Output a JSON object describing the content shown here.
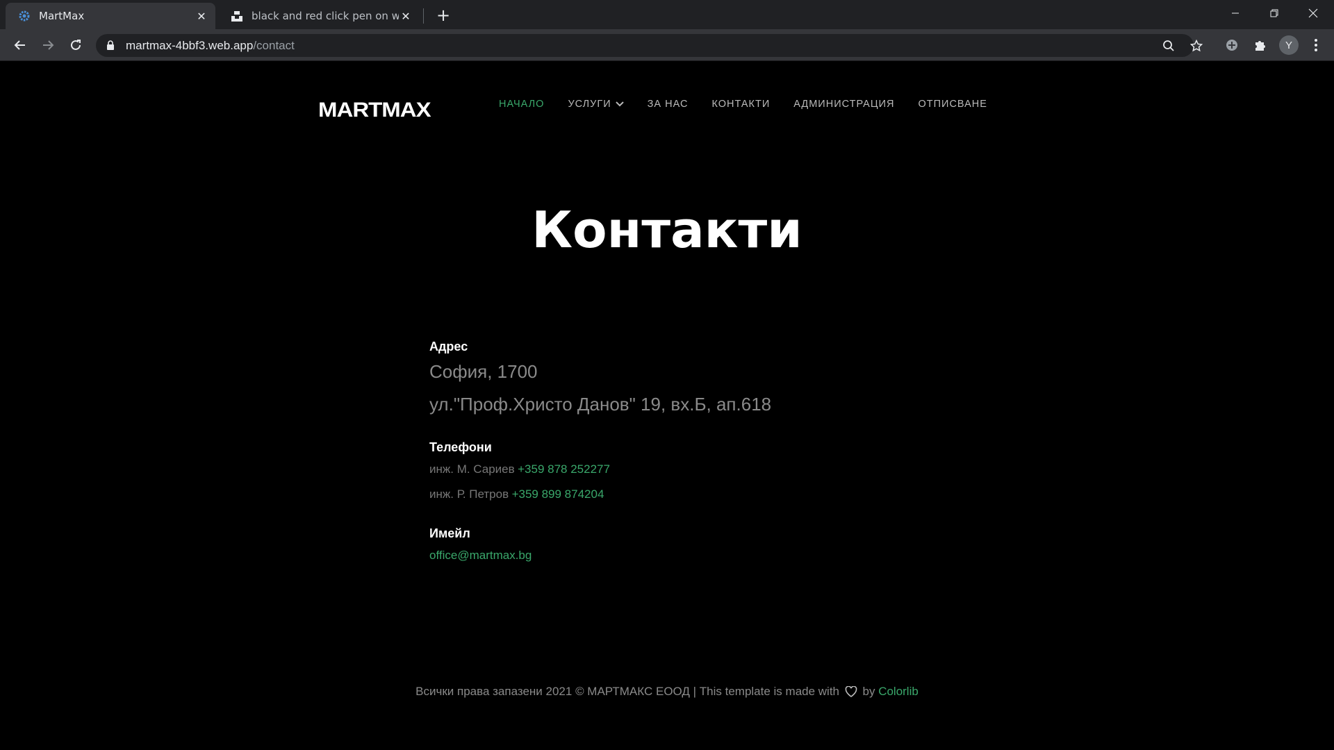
{
  "browser": {
    "tabs": [
      {
        "title": "MartMax",
        "active": true,
        "favicon": "gear-icon"
      },
      {
        "title": "black and red click pen on white",
        "active": false,
        "favicon": "unsplash-icon"
      }
    ],
    "url_host": "martmax-4bbf3.web.app",
    "url_path": "/contact",
    "profile_initial": "Y"
  },
  "site": {
    "logo": "MARTMAX",
    "nav": [
      {
        "label": "НАЧАЛО",
        "active": true
      },
      {
        "label": "УСЛУГИ",
        "active": false,
        "dropdown": true
      },
      {
        "label": "ЗА НАС",
        "active": false
      },
      {
        "label": "КОНТАКТИ",
        "active": false
      },
      {
        "label": "АДМИНИСТРАЦИЯ",
        "active": false
      },
      {
        "label": "ОТПИСВАНЕ",
        "active": false
      }
    ],
    "heading": "Контакти"
  },
  "contact": {
    "address_label": "Адрес",
    "address_line1": "София, 1700",
    "address_line2": "ул.\"Проф.Христо Данов\" 19, вх.Б, ап.618",
    "phones_label": "Телефони",
    "phones": [
      {
        "person": "инж. М. Сариев",
        "number": "+359 878 252277"
      },
      {
        "person": "инж. Р. Петров",
        "number": "+359 899 874204"
      }
    ],
    "email_label": "Имейл",
    "email": "office@martmax.bg"
  },
  "footer": {
    "text": "Всички права запазени 2021 © МАРТМАКС ЕООД  | This template is made with",
    "by": "by",
    "credit": "Colorlib"
  },
  "colors": {
    "accent": "#3aa86b",
    "background": "#000000",
    "chrome_dark": "#202124",
    "chrome_mid": "#35363a"
  }
}
